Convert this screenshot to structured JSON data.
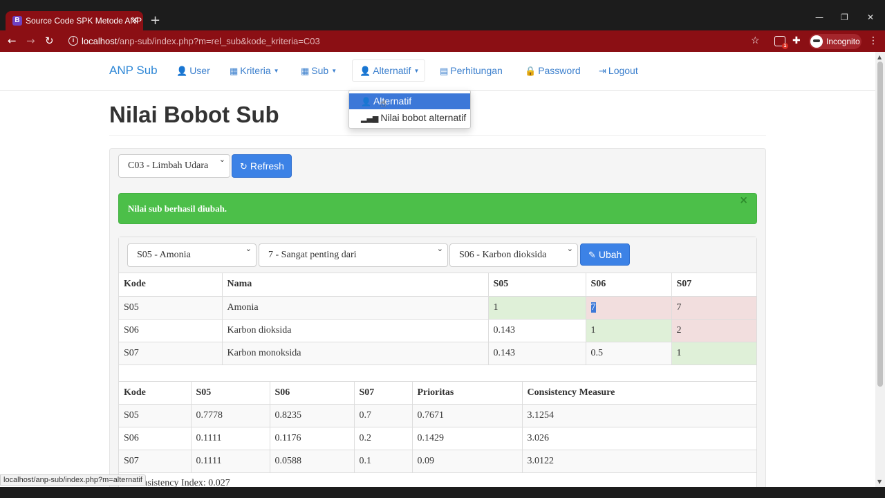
{
  "browser": {
    "tab_title": "Source Code SPK Metode ANP",
    "tab_favicon": "B",
    "url_host": "localhost",
    "url_path": "/anp-sub/index.php?m=rel_sub&kode_kriteria=C03",
    "incognito_label": "Incognito",
    "extension_badge": "1",
    "status_url": "localhost/anp-sub/index.php?m=alternatif"
  },
  "navbar": {
    "brand": "ANP Sub",
    "items": [
      {
        "label": "User",
        "icon": "user-icon"
      },
      {
        "label": "Kriteria",
        "icon": "grid-icon"
      },
      {
        "label": "Sub",
        "icon": "grid-icon"
      },
      {
        "label": "Alternatif",
        "icon": "user-icon"
      },
      {
        "label": "Perhitungan",
        "icon": "calendar-icon"
      },
      {
        "label": "Password",
        "icon": "lock-icon"
      },
      {
        "label": "Logout",
        "icon": "logout-icon"
      }
    ],
    "dropdown": [
      {
        "label": "Alternatif",
        "icon": "user-icon"
      },
      {
        "label": "Nilai bobot alternatif",
        "icon": "signal-icon"
      }
    ]
  },
  "page": {
    "title": "Nilai Bobot Sub",
    "criteria_select": "C03 - Limbah Udara",
    "refresh_label": "Refresh",
    "alert_text": "Nilai sub berhasil diubah.",
    "alert_close": "×"
  },
  "form": {
    "item1": "S05 - Amonia",
    "value": "7 - Sangat penting dari",
    "item2": "S06 - Karbon dioksida",
    "submit_label": "Ubah"
  },
  "matrix": {
    "headers": [
      "Kode",
      "Nama",
      "S05",
      "S06",
      "S07"
    ],
    "rows": [
      [
        "S05",
        "Amonia",
        "1",
        "7",
        "7"
      ],
      [
        "S06",
        "Karbon dioksida",
        "0.143",
        "1",
        "2"
      ],
      [
        "S07",
        "Karbon monoksida",
        "0.143",
        "0.5",
        "1"
      ]
    ]
  },
  "priority": {
    "headers": [
      "Kode",
      "S05",
      "S06",
      "S07",
      "Prioritas",
      "Consistency Measure"
    ],
    "rows": [
      [
        "S05",
        "0.7778",
        "0.8235",
        "0.7",
        "0.7671",
        "3.1254"
      ],
      [
        "S06",
        "0.1111",
        "0.1176",
        "0.2",
        "0.1429",
        "3.026"
      ],
      [
        "S07",
        "0.1111",
        "0.0588",
        "0.1",
        "0.09",
        "3.0122"
      ]
    ]
  },
  "consistency_index": "Consistency Index: 0.027",
  "colors": {
    "chrome_red": "#8b0f14",
    "link_blue": "#3b7fcd",
    "button_blue": "#3c82e6",
    "alert_green": "#4cbf49",
    "cell_ok": "#dff0d8",
    "cell_bad": "#f2dede"
  }
}
